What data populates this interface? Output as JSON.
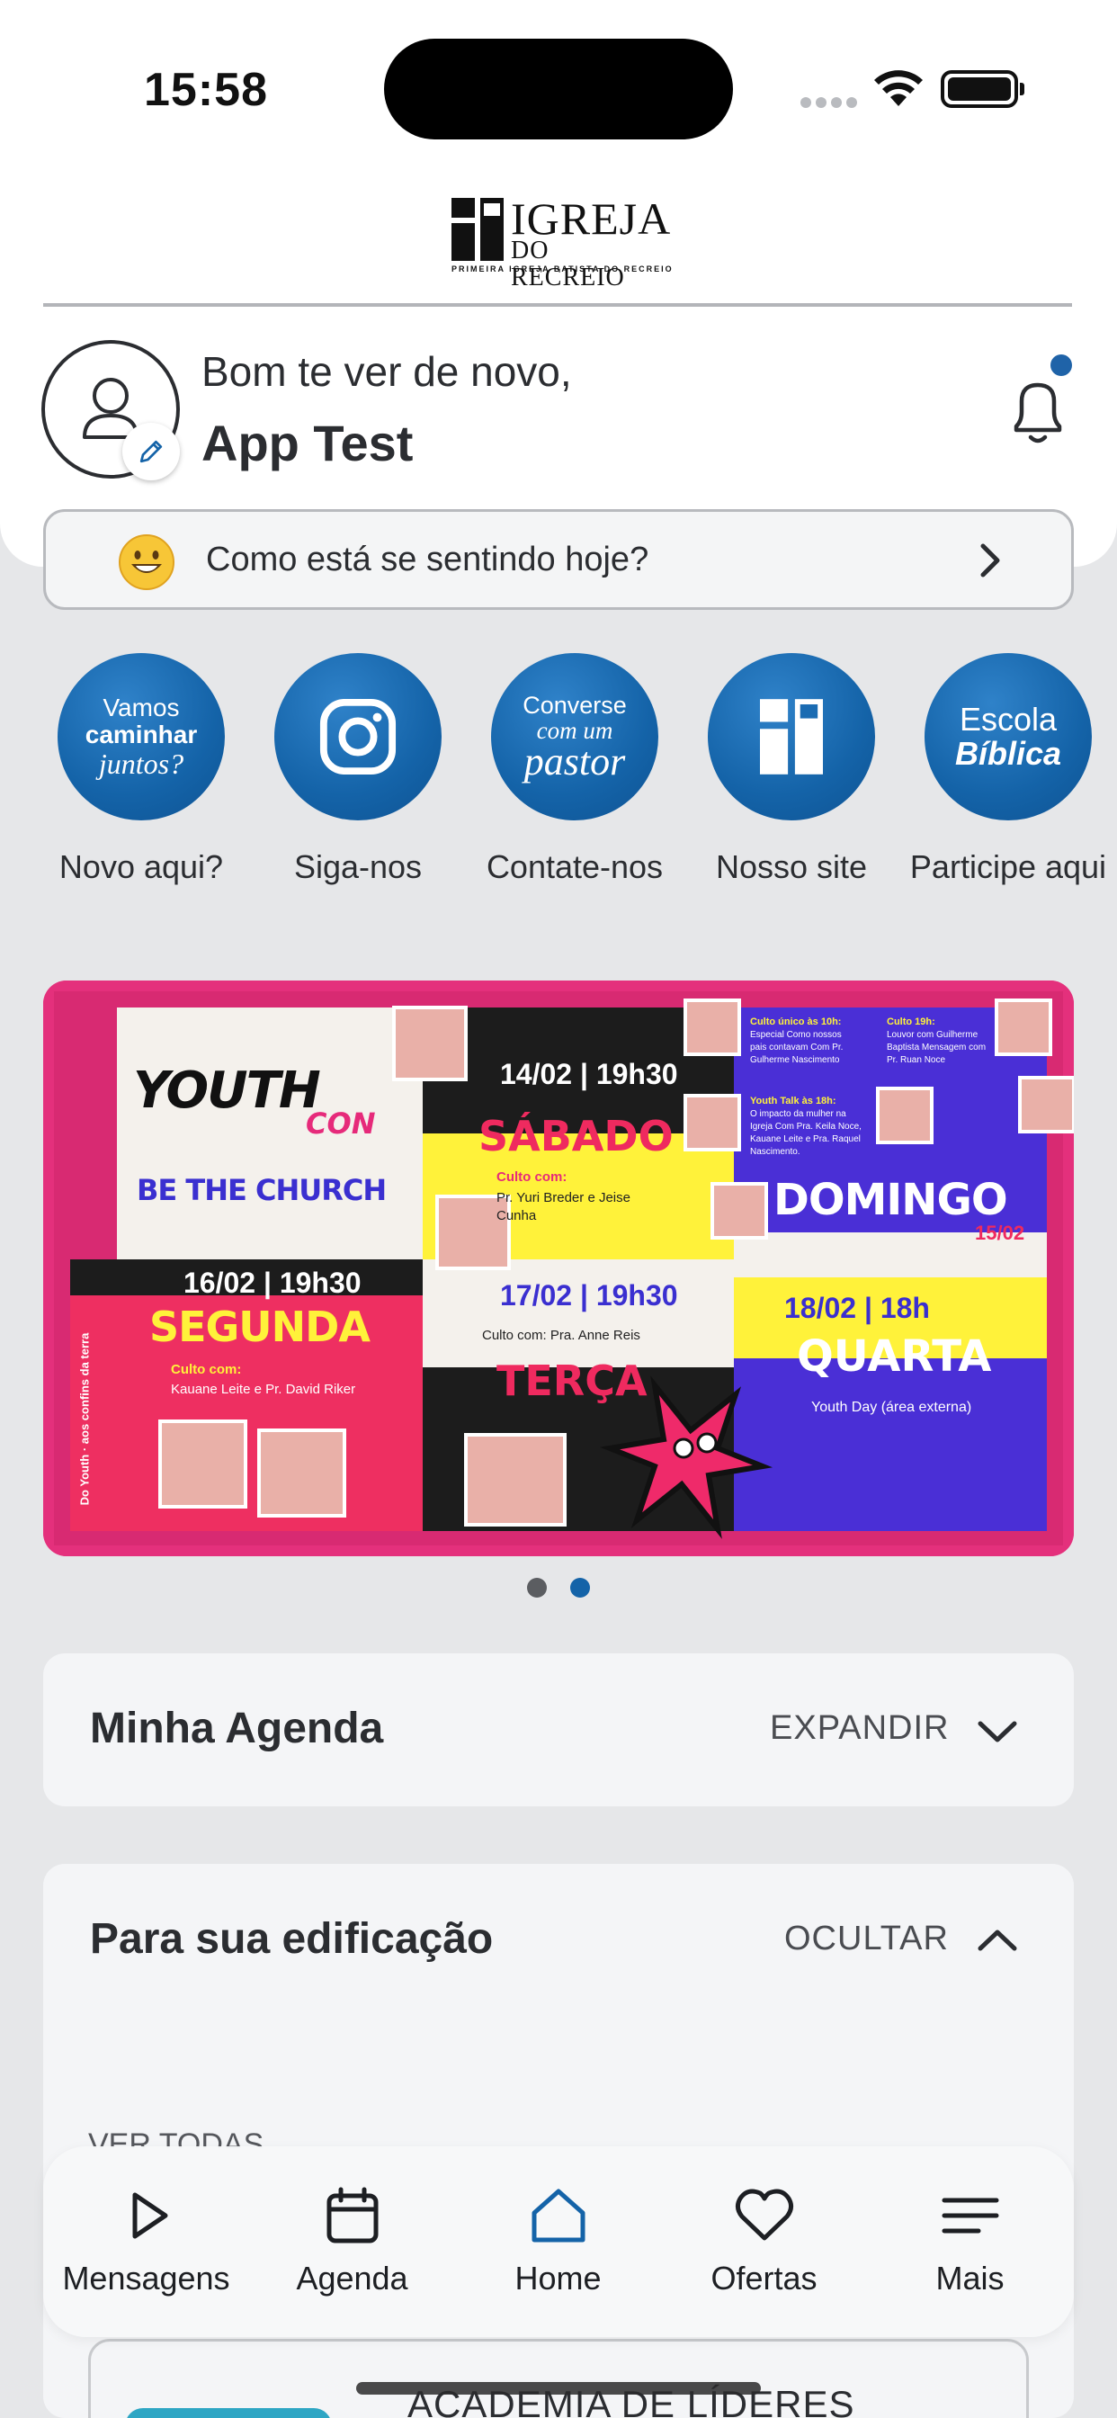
{
  "status_bar": {
    "time": "15:58"
  },
  "logo": {
    "title": "IGREJA",
    "subtitle": "DO RECREIO",
    "tagline": "PRIMEIRA IGREJA BATISTA DO RECREIO"
  },
  "greeting": {
    "line": "Bom te ver de novo,",
    "name": "App Test"
  },
  "mood": {
    "prompt": "Como está se sentindo hoje?"
  },
  "quick_actions": [
    {
      "label": "Novo aqui?",
      "circle_text": [
        "Vamos",
        "caminhar",
        "juntos?"
      ],
      "icon": "walk-together-icon"
    },
    {
      "label": "Siga-nos",
      "circle_text": [],
      "icon": "instagram-icon"
    },
    {
      "label": "Contate-nos",
      "circle_text": [
        "Converse",
        "com um",
        "pastor"
      ],
      "icon": "pastor-chat-icon"
    },
    {
      "label": "Nosso site",
      "circle_text": [],
      "icon": "church-logo-icon"
    },
    {
      "label": "Participe aqui",
      "circle_text": [
        "Escola",
        "Bíblica"
      ],
      "icon": "bible-school-icon"
    }
  ],
  "banner": {
    "brand_1": "YOUTH",
    "brand_2": "CON",
    "brand_tagline": "BE THE CHURCH",
    "side_text": "Do Youth · aos confins da terra",
    "sabado": {
      "when": "14/02 | 19h30",
      "day": "SÁBADO",
      "head": "Culto com:",
      "names": "Pr. Yuri Breder e Jeise Cunha"
    },
    "domingo": {
      "day": "DOMINGO",
      "date": "15/02",
      "culto10_title": "Culto único às 10h:",
      "culto10_text": "Especial Como nossos pais contavam Com Pr. Gulherme Nascimento",
      "culto19_title": "Culto 19h:",
      "culto19_text": "Louvor com Guilherme Baptista Mensagem com Pr. Ruan Noce",
      "talk_title": "Youth Talk às 18h:",
      "talk_text": "O impacto da mulher na Igreja Com Pra. Keila Noce, Kauane Leite e Pra. Raquel Nascimento."
    },
    "segunda": {
      "when": "16/02 | 19h30",
      "day": "SEGUNDA",
      "head": "Culto com:",
      "names": "Kauane Leite e Pr. David Riker"
    },
    "terca": {
      "when": "17/02 | 19h30",
      "day": "TERÇA",
      "names": "Culto com: Pra. Anne Reis"
    },
    "quarta": {
      "when": "18/02 | 18h",
      "day": "QUARTA",
      "names": "Youth Day (área externa)"
    }
  },
  "carousel": {
    "active_index": 1,
    "count": 2
  },
  "agenda_card": {
    "title": "Minha Agenda",
    "action": "EXPANDIR"
  },
  "edification_card": {
    "title": "Para sua edificação",
    "action": "OCULTAR",
    "see_all": "VER TODAS"
  },
  "bottom_nav": [
    {
      "label": "Mensagens",
      "icon": "play-icon"
    },
    {
      "label": "Agenda",
      "icon": "calendar-icon"
    },
    {
      "label": "Home",
      "icon": "home-icon",
      "active": true
    },
    {
      "label": "Ofertas",
      "icon": "heart-icon"
    },
    {
      "label": "Mais",
      "icon": "menu-icon"
    }
  ],
  "academy": {
    "title": "ACADEMIA DE LÍDERES"
  },
  "colors": {
    "brand_blue": "#1463a8",
    "background": "#e6e7e9",
    "card": "#f4f5f7",
    "banner_pink": "#e62a7a",
    "banner_yellow": "#fff23a",
    "banner_purple": "#4a2fd6"
  }
}
